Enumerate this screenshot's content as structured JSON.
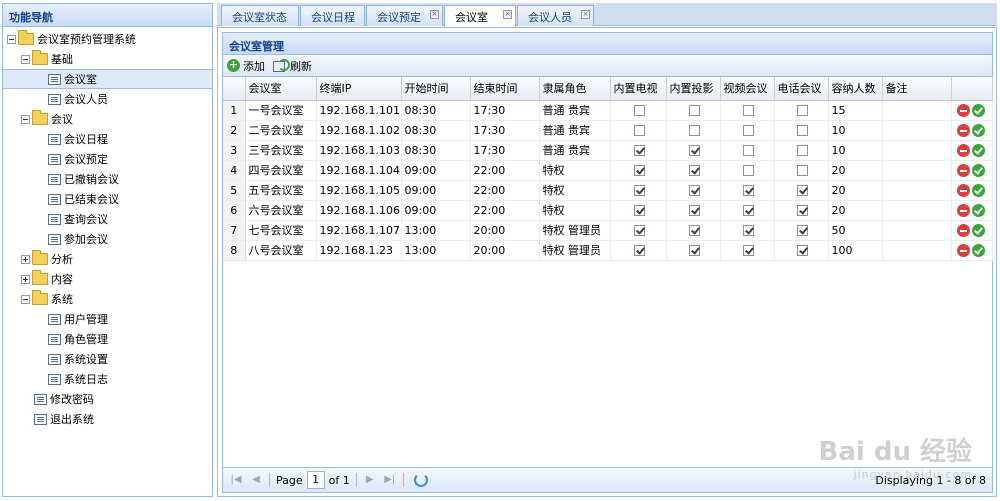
{
  "sidebar": {
    "title": "功能导航",
    "tree": [
      {
        "label": "会议室预约管理系统",
        "level": 0,
        "type": "folder",
        "toggle": "minus"
      },
      {
        "label": "基础",
        "level": 1,
        "type": "folder",
        "toggle": "minus"
      },
      {
        "label": "会议室",
        "level": 2,
        "type": "leaf",
        "selected": true
      },
      {
        "label": "会议人员",
        "level": 2,
        "type": "leaf"
      },
      {
        "label": "会议",
        "level": 1,
        "type": "folder",
        "toggle": "minus"
      },
      {
        "label": "会议日程",
        "level": 2,
        "type": "leaf"
      },
      {
        "label": "会议预定",
        "level": 2,
        "type": "leaf"
      },
      {
        "label": "已撤销会议",
        "level": 2,
        "type": "leaf"
      },
      {
        "label": "已结束会议",
        "level": 2,
        "type": "leaf"
      },
      {
        "label": "查询会议",
        "level": 2,
        "type": "leaf"
      },
      {
        "label": "参加会议",
        "level": 2,
        "type": "leaf"
      },
      {
        "label": "分析",
        "level": 1,
        "type": "folder",
        "toggle": "plus"
      },
      {
        "label": "内容",
        "level": 1,
        "type": "folder",
        "toggle": "plus"
      },
      {
        "label": "系统",
        "level": 1,
        "type": "folder",
        "toggle": "minus"
      },
      {
        "label": "用户管理",
        "level": 2,
        "type": "leaf"
      },
      {
        "label": "角色管理",
        "level": 2,
        "type": "leaf"
      },
      {
        "label": "系统设置",
        "level": 2,
        "type": "leaf"
      },
      {
        "label": "系统日志",
        "level": 2,
        "type": "leaf"
      },
      {
        "label": "修改密码",
        "level": 1,
        "type": "leaf"
      },
      {
        "label": "退出系统",
        "level": 1,
        "type": "leaf"
      }
    ]
  },
  "tabs": [
    {
      "label": "会议室状态",
      "closable": false,
      "active": false
    },
    {
      "label": "会议日程",
      "closable": false,
      "active": false
    },
    {
      "label": "会议预定",
      "closable": true,
      "active": false
    },
    {
      "label": "会议室",
      "closable": true,
      "active": true
    },
    {
      "label": "会议人员",
      "closable": true,
      "active": false
    }
  ],
  "main": {
    "title": "会议室管理",
    "toolbar": {
      "add_label": "添加",
      "refresh_label": "刷新"
    },
    "columns": [
      "会议室",
      "终端IP",
      "开始时间",
      "结束时间",
      "隶属角色",
      "内置电视",
      "内置投影",
      "视频会议",
      "电话会议",
      "容纳人数",
      "备注"
    ],
    "rows": [
      {
        "num": "1",
        "name": "一号会议室",
        "ip": "192.168.1.101",
        "start": "08:30",
        "end": "17:30",
        "role": "普通 贵宾",
        "tv": false,
        "proj": false,
        "video": false,
        "phone": false,
        "capacity": "15",
        "note": ""
      },
      {
        "num": "2",
        "name": "二号会议室",
        "ip": "192.168.1.102",
        "start": "08:30",
        "end": "17:30",
        "role": "普通 贵宾",
        "tv": false,
        "proj": false,
        "video": false,
        "phone": false,
        "capacity": "10",
        "note": ""
      },
      {
        "num": "3",
        "name": "三号会议室",
        "ip": "192.168.1.103",
        "start": "08:30",
        "end": "17:30",
        "role": "普通 贵宾",
        "tv": true,
        "proj": true,
        "video": false,
        "phone": false,
        "capacity": "10",
        "note": ""
      },
      {
        "num": "4",
        "name": "四号会议室",
        "ip": "192.168.1.104",
        "start": "09:00",
        "end": "22:00",
        "role": "特权",
        "tv": true,
        "proj": true,
        "video": false,
        "phone": false,
        "capacity": "20",
        "note": ""
      },
      {
        "num": "5",
        "name": "五号会议室",
        "ip": "192.168.1.105",
        "start": "09:00",
        "end": "22:00",
        "role": "特权",
        "tv": true,
        "proj": true,
        "video": true,
        "phone": true,
        "capacity": "20",
        "note": ""
      },
      {
        "num": "6",
        "name": "六号会议室",
        "ip": "192.168.1.106",
        "start": "09:00",
        "end": "22:00",
        "role": "特权",
        "tv": true,
        "proj": true,
        "video": true,
        "phone": true,
        "capacity": "20",
        "note": ""
      },
      {
        "num": "7",
        "name": "七号会议室",
        "ip": "192.168.1.107",
        "start": "13:00",
        "end": "20:00",
        "role": "特权 管理员",
        "tv": true,
        "proj": true,
        "video": true,
        "phone": true,
        "capacity": "50",
        "note": ""
      },
      {
        "num": "8",
        "name": "八号会议室",
        "ip": "192.168.1.23",
        "start": "13:00",
        "end": "20:00",
        "role": "特权 管理员",
        "tv": true,
        "proj": true,
        "video": true,
        "phone": true,
        "capacity": "100",
        "note": ""
      }
    ],
    "pager": {
      "page_label": "Page",
      "page_value": "1",
      "of_label": "of 1",
      "display_text": "Displaying 1 - 8 of 8"
    }
  },
  "watermark": {
    "brand": "Bai du 经验",
    "url": "jingyan.baidu.com"
  },
  "icons": {
    "tree_folder": "folder-icon",
    "tree_leaf": "document-icon",
    "add": "add-icon",
    "refresh": "refresh-icon",
    "row_delete": "delete-icon",
    "row_confirm": "check-icon",
    "pager_first": "first-page-icon",
    "pager_prev": "prev-page-icon",
    "pager_next": "next-page-icon",
    "pager_last": "last-page-icon",
    "pager_refresh": "refresh-icon",
    "tab_close": "close-icon"
  }
}
